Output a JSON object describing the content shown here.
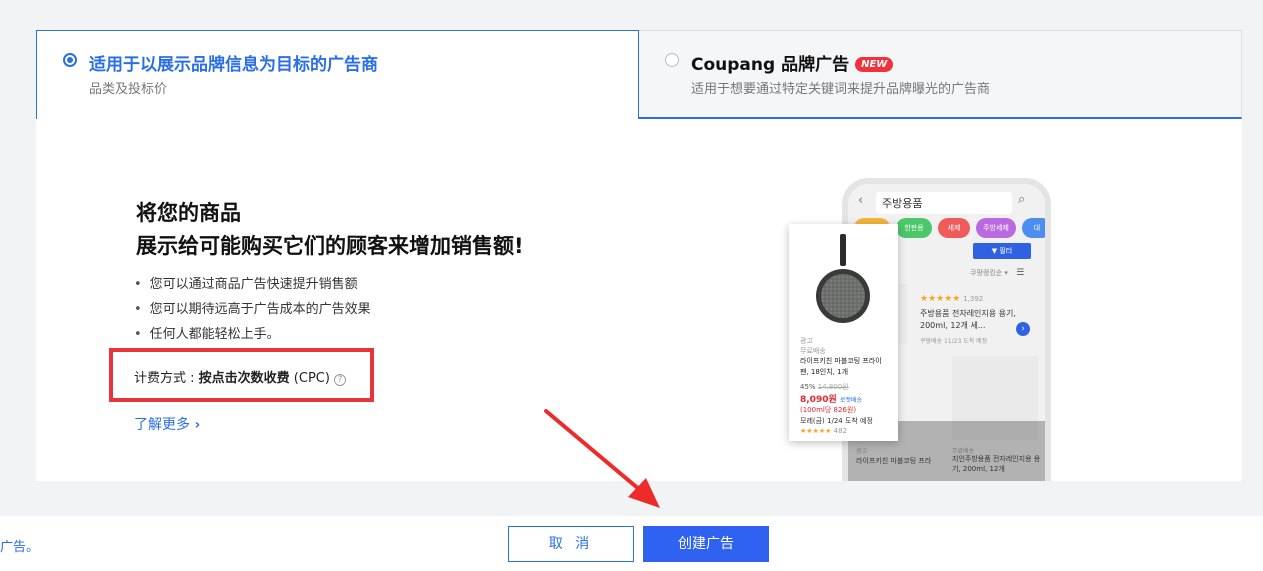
{
  "tabs": [
    {
      "title": "适用于以展示品牌信息为目标的广告商",
      "subtitle": "品类及投标价",
      "selected": true
    },
    {
      "title": "Coupang 品牌广告",
      "badge": "NEW",
      "subtitle": "适用于想要通过特定关键词来提升品牌曝光的广告商",
      "selected": false
    }
  ],
  "main": {
    "headline_line1": "将您的商品",
    "headline_line2": "展示给可能购买它们的顾客来增加销售额!",
    "bullets": [
      "您可以通过商品广告快速提升销售额",
      "您可以期待远高于广告成本的广告效果",
      "任何人都能轻松上手。"
    ],
    "billing_label": "计费方式 : ",
    "billing_value": "按点击次数收费",
    "billing_suffix": " (CPC)",
    "help_icon": "?",
    "learn_more": "了解更多",
    "learn_more_icon": "›"
  },
  "phone": {
    "search_text": "주방용품",
    "back_icon": "‹",
    "search_icon": "⌕",
    "chips": [
      "한판용",
      "세제",
      "주방세제",
      "대"
    ],
    "filter_label": "▼ 필터",
    "sort_label": "쿠팡랭킹순 ▾",
    "list_icon": "☰",
    "stars": "★★★★★",
    "review_count": "1,392",
    "item_name": "주방용품 전자레인지용 용기, 200ml, 12개 세...",
    "item_delivery": "쿠팡배송  11/23 도착 예정",
    "next_icon": "›",
    "ship_label": "무료배송",
    "item2_name": "지인주방용품 전자레인지용 용기, 200ml, 12개",
    "ad_label": "광고",
    "item3_name": "라이프키친 마블코팅 프라"
  },
  "card": {
    "ad_label": "광고",
    "ship_label": "무료배송",
    "name": "라이프키친 마블코팅 프라이팬, 18인치, 1개",
    "discount": "45%",
    "original_price": "14,800원",
    "price": "8,090원",
    "rocket": "로켓배송",
    "unit_price": "(100ml당 826원)",
    "delivery": "모레(금) 1/24 도착 예정",
    "stars": "★★★★★",
    "review_count": "482"
  },
  "footer": {
    "note": "广告。",
    "cancel_label": "取 消",
    "create_label": "创建广告"
  },
  "colors": {
    "accent": "#2b6fe6",
    "primary_button": "#2f62f0",
    "highlight": "#e8333b",
    "badge": "#f0333a"
  }
}
